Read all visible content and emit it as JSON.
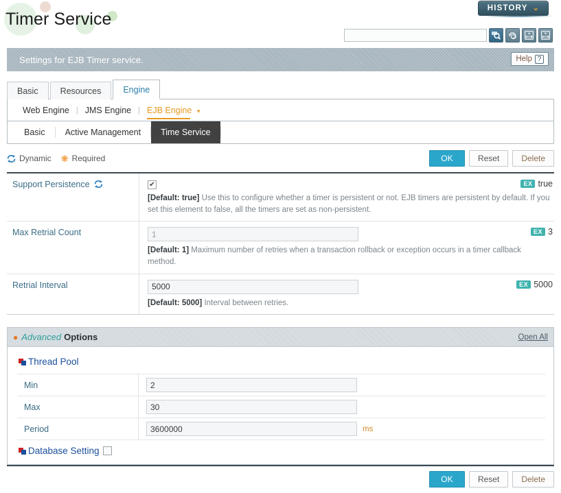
{
  "header": {
    "title": "Timer Service",
    "history_label": "HISTORY",
    "history_chevron": "⌄",
    "search_value": "",
    "search_placeholder": "",
    "icons": [
      {
        "name": "search-icon",
        "title": "Search"
      },
      {
        "name": "refresh-icon",
        "title": "Refresh"
      },
      {
        "name": "xml-import-icon",
        "title": "Import XML"
      },
      {
        "name": "xml-export-icon",
        "title": "Export XML"
      }
    ]
  },
  "banner": {
    "text": "Settings for EJB Timer service.",
    "help_label": "Help",
    "help_glyph": "?"
  },
  "tabs_level1": [
    {
      "label": "Basic",
      "selected": false
    },
    {
      "label": "Resources",
      "selected": false
    },
    {
      "label": "Engine",
      "selected": true
    }
  ],
  "tabs_level2": [
    {
      "label": "Web Engine",
      "selected": false
    },
    {
      "label": "JMS Engine",
      "selected": false
    },
    {
      "label": "EJB Engine",
      "selected": true,
      "chevron": "▾"
    }
  ],
  "tabs_level3": [
    {
      "label": "Basic",
      "selected": false
    },
    {
      "label": "Active Management",
      "selected": false
    },
    {
      "label": "Time Service",
      "selected": true
    }
  ],
  "legend": [
    {
      "label": "Dynamic",
      "icon": "dynamic-sync-icon"
    },
    {
      "label": "Required",
      "icon": "required-asterisk-icon"
    }
  ],
  "toolbar_buttons": [
    {
      "label": "OK",
      "style": "primary"
    },
    {
      "label": "Reset",
      "style": "default"
    },
    {
      "label": "Delete",
      "style": "delete"
    }
  ],
  "form_rows": [
    {
      "label": "Support Persistence",
      "has_dynamic_icon": true,
      "control": "checkbox",
      "checked": true,
      "check_glyph": "✔",
      "hint_default": "[Default: true]",
      "hint_text": "Use this to configure whether a timer is persistent or not. EJB timers are persistent by default. If you set this element to false, all the timers are set as non-persistent.",
      "ex_badge": "EX",
      "ex_value": "true"
    },
    {
      "label": "Max Retrial Count",
      "has_dynamic_icon": false,
      "control": "text",
      "value": "1",
      "value_is_placeholder": true,
      "hint_default": "[Default: 1]",
      "hint_text": "Maximum number of retries when a transaction rollback or exception occurs in a timer callback method.",
      "ex_badge": "EX",
      "ex_value": "3"
    },
    {
      "label": "Retrial Interval",
      "has_dynamic_icon": false,
      "control": "text",
      "value": "5000",
      "value_is_placeholder": false,
      "hint_default": "[Default: 5000]",
      "hint_text": "Interval between retries.",
      "ex_badge": "EX",
      "ex_value": "5000"
    }
  ],
  "advanced": {
    "title_italic": "Advanced",
    "title_bold": "Options",
    "pin_glyph": "⌘",
    "open_all": "Open All",
    "groups": [
      {
        "name": "Thread Pool",
        "has_checkbox": false,
        "rows": [
          {
            "label": "Min",
            "value": "2",
            "unit": ""
          },
          {
            "label": "Max",
            "value": "30",
            "unit": ""
          },
          {
            "label": "Period",
            "value": "3600000",
            "unit": "ms"
          }
        ]
      },
      {
        "name": "Database Setting",
        "has_checkbox": true,
        "checked": false,
        "rows": []
      }
    ]
  },
  "footer_buttons": [
    {
      "label": "OK",
      "style": "primary"
    },
    {
      "label": "Reset",
      "style": "default"
    },
    {
      "label": "Delete",
      "style": "delete"
    }
  ]
}
